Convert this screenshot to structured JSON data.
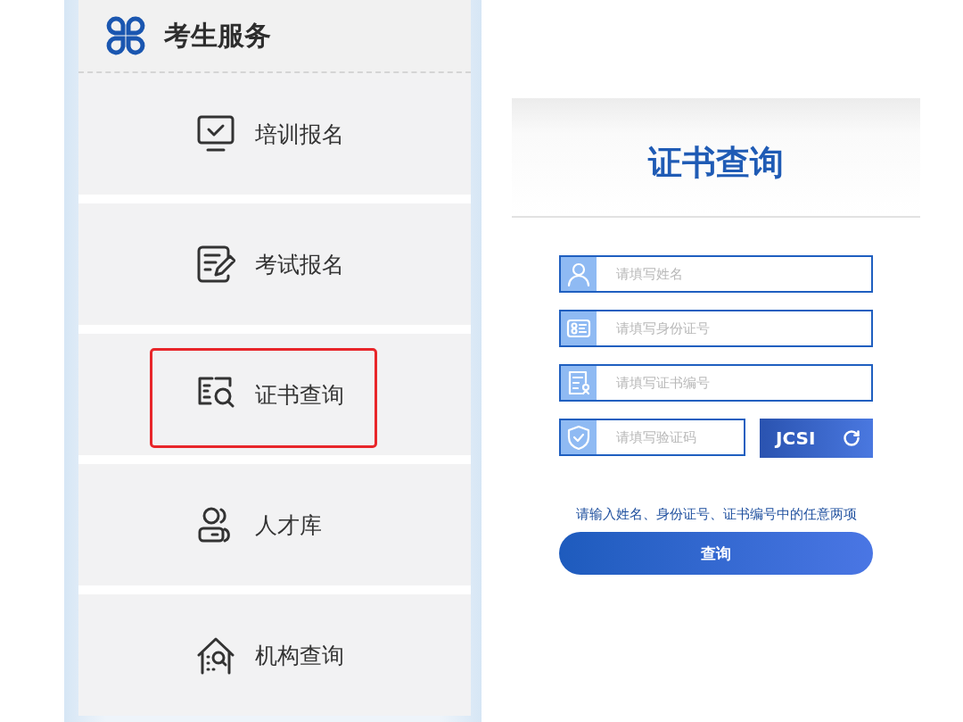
{
  "sidebar": {
    "title": "考生服务",
    "items": [
      {
        "label": "培训报名",
        "kind": "monitor",
        "highlighted": false
      },
      {
        "label": "考试报名",
        "kind": "edit",
        "highlighted": false
      },
      {
        "label": "证书查询",
        "kind": "search-doc",
        "highlighted": true
      },
      {
        "label": "人才库",
        "kind": "people",
        "highlighted": false
      },
      {
        "label": "机构查询",
        "kind": "house",
        "highlighted": false
      }
    ]
  },
  "form": {
    "title": "证书查询",
    "fields": [
      {
        "kind": "person",
        "placeholder": "请填写姓名"
      },
      {
        "kind": "id-card",
        "placeholder": "请填写身份证号"
      },
      {
        "kind": "certificate",
        "placeholder": "请填写证书编号"
      },
      {
        "kind": "shield",
        "placeholder": "请填写验证码"
      }
    ],
    "captcha": "JCSI",
    "hint": "请输入姓名、身份证号、证书编号中的任意两项",
    "submit": "查询"
  }
}
